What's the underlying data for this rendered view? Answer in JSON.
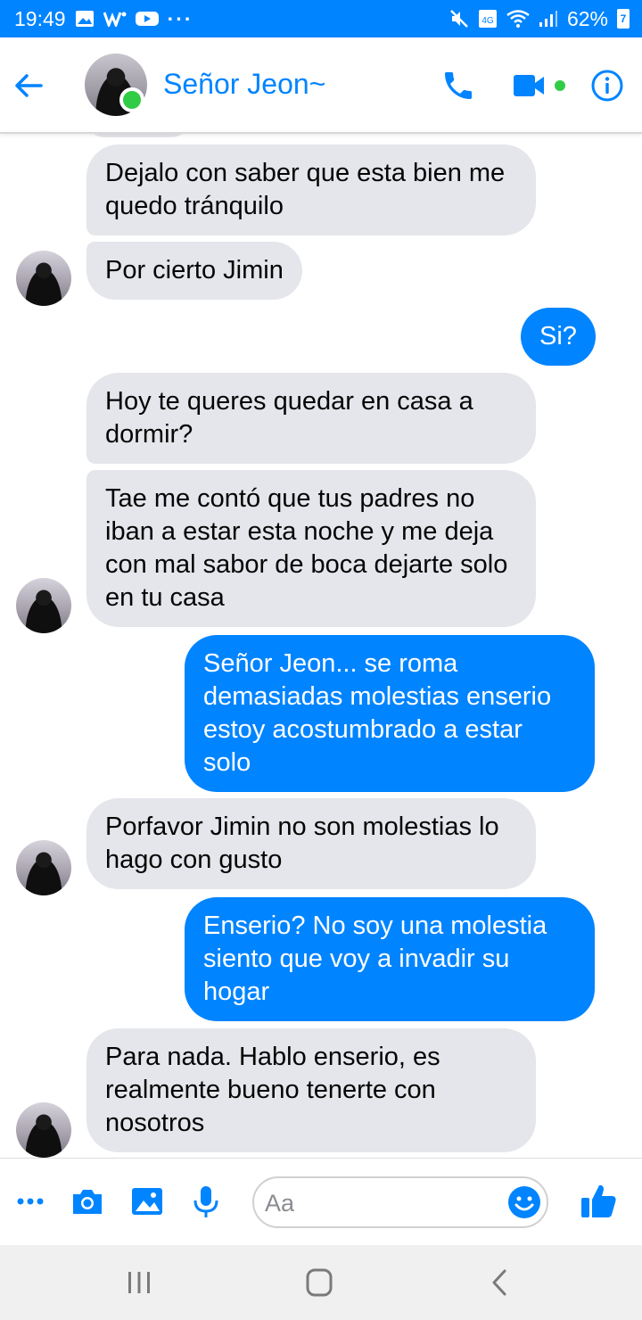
{
  "status_bar": {
    "time": "19:49",
    "dots": "···",
    "signal_label": "4G",
    "battery_percent": "62%",
    "battery_icon_text": "7"
  },
  "header": {
    "contact_name": "Señor Jeon~",
    "online": true,
    "accent_color": "#0084ff",
    "online_color": "#31cc46"
  },
  "messages": [
    {
      "sender": "them",
      "text": "Dejalo con saber que esta bien me quedo tránquilo",
      "avatar": false
    },
    {
      "sender": "them",
      "text": "Por cierto Jimin",
      "avatar": true
    },
    {
      "sender": "me",
      "text": "Si?"
    },
    {
      "sender": "them",
      "text": "Hoy te queres quedar en casa a dormir?",
      "avatar": false
    },
    {
      "sender": "them",
      "text": "Tae me contó que tus padres no iban a estar esta noche y me deja con mal sabor de boca dejarte solo en tu casa",
      "avatar": true
    },
    {
      "sender": "me",
      "text": "Señor Jeon... se roma demasiadas molestias enserio estoy acostumbrado a estar solo"
    },
    {
      "sender": "them",
      "text": "Porfavor Jimin no son molestias lo hago con gusto",
      "avatar": true
    },
    {
      "sender": "me",
      "text": "Enserio? No soy una molestia siento que voy a invadir su hogar"
    },
    {
      "sender": "them",
      "text": "Para nada. Hablo enserio, es realmente bueno tenerte con nosotros",
      "avatar": true
    }
  ],
  "composer": {
    "placeholder": "Aa",
    "icons": [
      "more-icon",
      "camera-icon",
      "gallery-icon",
      "microphone-icon",
      "emoji-icon",
      "thumbs-up-icon"
    ]
  },
  "nav_bar": {
    "icons": [
      "recent-apps-icon",
      "home-icon",
      "back-icon"
    ]
  }
}
